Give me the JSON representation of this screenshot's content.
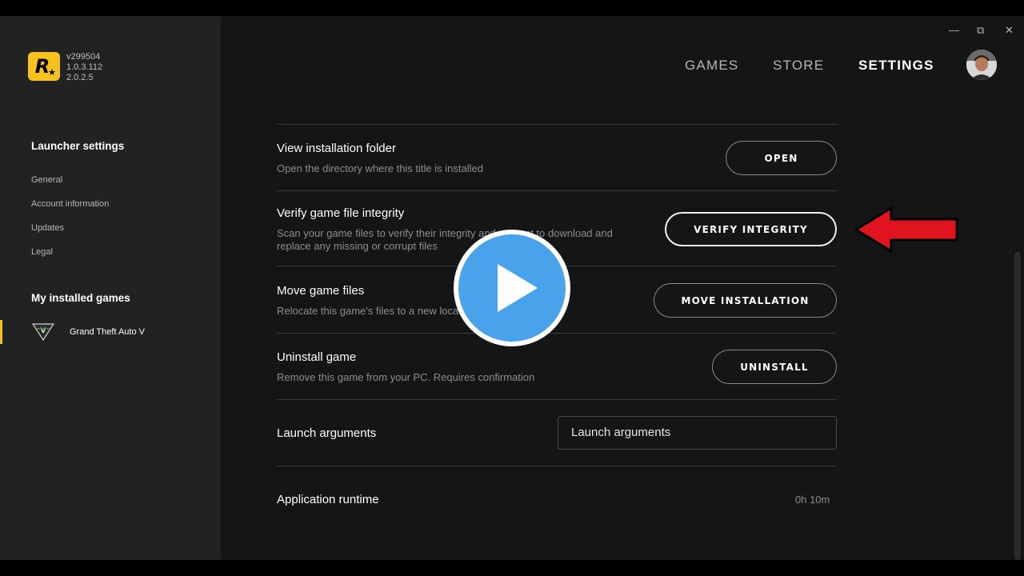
{
  "sidebar": {
    "version_lines": [
      "v299504",
      "1.0.3.112",
      "2.0.2.5"
    ],
    "launcher_settings_title": "Launcher settings",
    "items": [
      "General",
      "Account information",
      "Updates",
      "Legal"
    ],
    "installed_games_title": "My installed games",
    "game_name": "Grand Theft Auto V"
  },
  "window": {
    "minimize": "—",
    "restore": "⧉",
    "close": "✕"
  },
  "nav": {
    "games": "GAMES",
    "store": "STORE",
    "settings": "SETTINGS"
  },
  "settings": {
    "view_folder": {
      "title": "View installation folder",
      "desc": "Open the directory where this title is installed",
      "button": "OPEN"
    },
    "verify": {
      "title": "Verify game file integrity",
      "desc": "Scan your game files to verify their integrity and attempt to download and replace any missing or corrupt files",
      "button": "VERIFY INTEGRITY"
    },
    "move": {
      "title": "Move game files",
      "desc": "Relocate this game's files to a new location",
      "button": "MOVE INSTALLATION"
    },
    "uninstall": {
      "title": "Uninstall game",
      "desc": "Remove this game from your PC. Requires confirmation",
      "button": "UNINSTALL"
    },
    "launch_args": {
      "title": "Launch arguments",
      "placeholder": "Launch arguments"
    },
    "runtime": {
      "title": "Application runtime",
      "value": "0h 10m"
    }
  },
  "colors": {
    "accent": "#f9c11c",
    "background": "#151515",
    "sidebar": "#222222",
    "annotation_arrow": "#e0141e",
    "play_button": "#4aa3ea"
  }
}
